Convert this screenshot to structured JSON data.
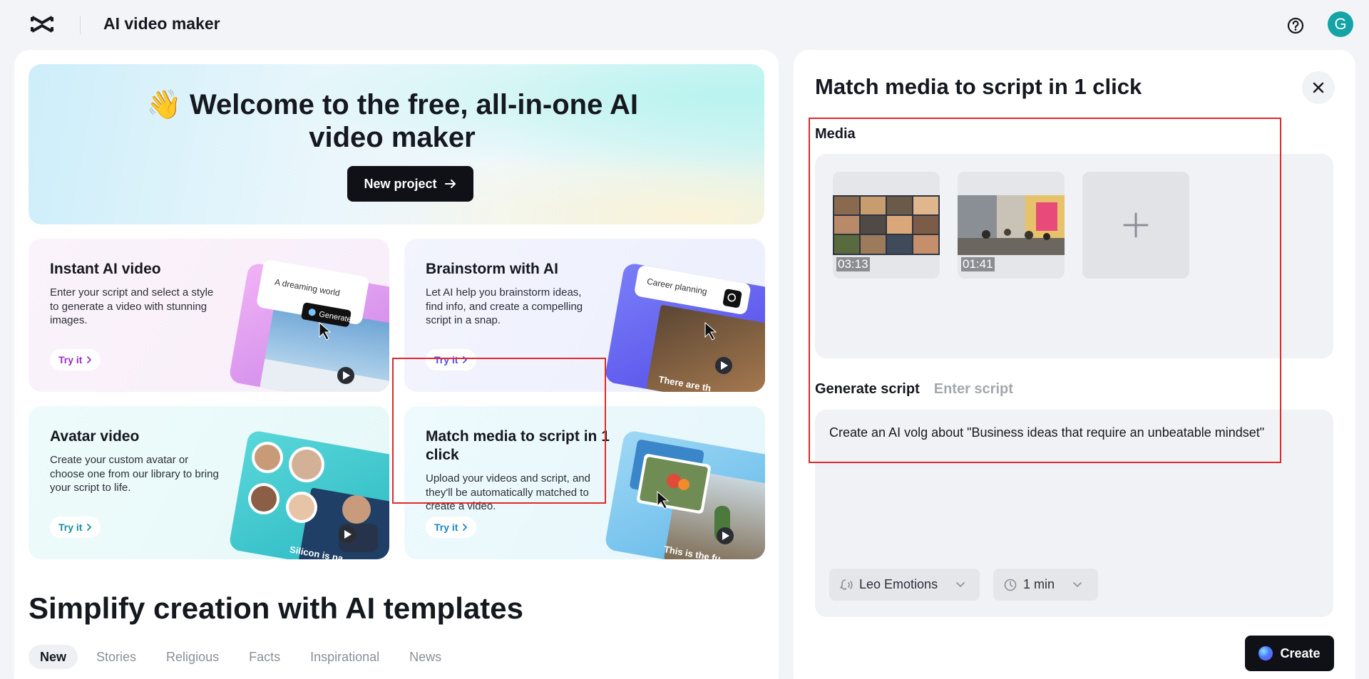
{
  "app": {
    "title": "AI video maker",
    "user_initial": "G"
  },
  "hero": {
    "emoji": "👋",
    "title": "Welcome to the free, all-in-one AI video maker",
    "new_project_label": "New project"
  },
  "cards": [
    {
      "title": "Instant AI video",
      "desc": "Enter your script and select a style to generate a video with stunning images.",
      "cta": "Try it",
      "art_prompt": "A dreaming world",
      "art_button": "Generate",
      "accent": "#9b2fc9"
    },
    {
      "title": "Brainstorm with AI",
      "desc": "Let AI help you brainstorm ideas, find info, and create a compelling script in a snap.",
      "cta": "Try it",
      "art_prompt": "Career planning",
      "art_caption": "There are th",
      "accent": "#4b4ff0"
    },
    {
      "title": "Avatar video",
      "desc": "Create your custom avatar or choose one from our library to bring your script to life.",
      "cta": "Try it",
      "art_caption": "Silicon is pa",
      "accent": "#148fa0"
    },
    {
      "title": "Match media to script in 1 click",
      "desc": "Upload your videos and script, and they'll be automatically matched to create a video.",
      "cta": "Try it",
      "art_caption": "This is the fu",
      "accent": "#1a86c9"
    }
  ],
  "templates": {
    "title": "Simplify creation with AI templates",
    "tabs": [
      "New",
      "Stories",
      "Religious",
      "Facts",
      "Inspirational",
      "News"
    ],
    "active_tab": "New"
  },
  "panel": {
    "title": "Match media to script in 1 click",
    "media_label": "Media",
    "media": [
      {
        "duration": "03:13",
        "icon": "video-grid-thumbnail"
      },
      {
        "duration": "01:41",
        "icon": "street-scene-thumbnail"
      }
    ],
    "script_tabs": [
      "Generate script",
      "Enter script"
    ],
    "active_script_tab": "Generate script",
    "script_text": "Create an AI volg about \"Business ideas that require an unbeatable mindset\"",
    "voice": "Leo Emotions",
    "duration": "1 min",
    "create_label": "Create"
  },
  "colors": {
    "highlight": "#e0282b",
    "primary_button": "#0f1117",
    "avatar": "#14a3a6"
  }
}
